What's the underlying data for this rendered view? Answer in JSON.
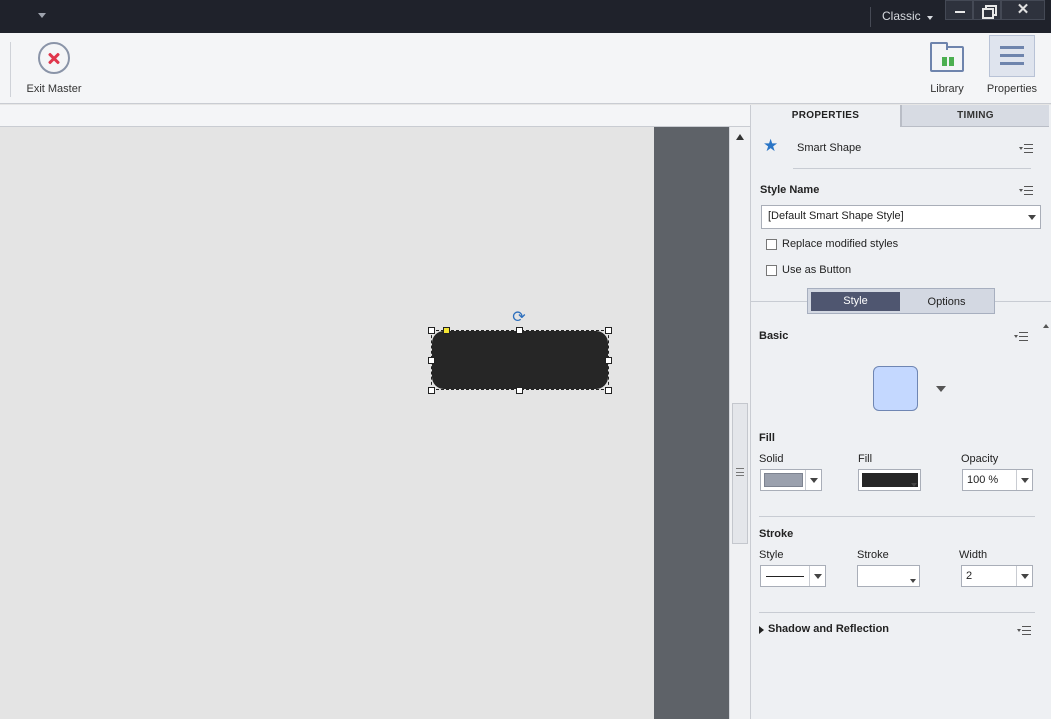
{
  "titlebar": {
    "workspace": "Classic",
    "close_glyph": "✕"
  },
  "toolbar": {
    "exit_master_label": "Exit Master",
    "library_label": "Library",
    "properties_label": "Properties"
  },
  "panel": {
    "tabs": [
      "PROPERTIES",
      "TIMING"
    ],
    "object_type": "Smart Shape",
    "style_name_label": "Style Name",
    "style_name_value": "[Default Smart Shape Style]",
    "replace_modified_label": "Replace modified styles",
    "use_as_button_label": "Use as Button",
    "toggle": {
      "style": "Style",
      "options": "Options"
    },
    "basic_label": "Basic",
    "fill_section": {
      "title": "Fill",
      "solid_label": "Solid",
      "fill_label": "Fill",
      "opacity_label": "Opacity",
      "opacity_value": "100 %"
    },
    "stroke_section": {
      "title": "Stroke",
      "style_label": "Style",
      "stroke_label": "Stroke",
      "width_label": "Width",
      "width_value": "2"
    },
    "shadow_label": "Shadow and Reflection"
  },
  "colors": {
    "shape_fill": "#262626",
    "basic_swatch": "#c4d8ff",
    "solid_sample": "#9aa0ad",
    "accent_star": "#2a75c6"
  }
}
